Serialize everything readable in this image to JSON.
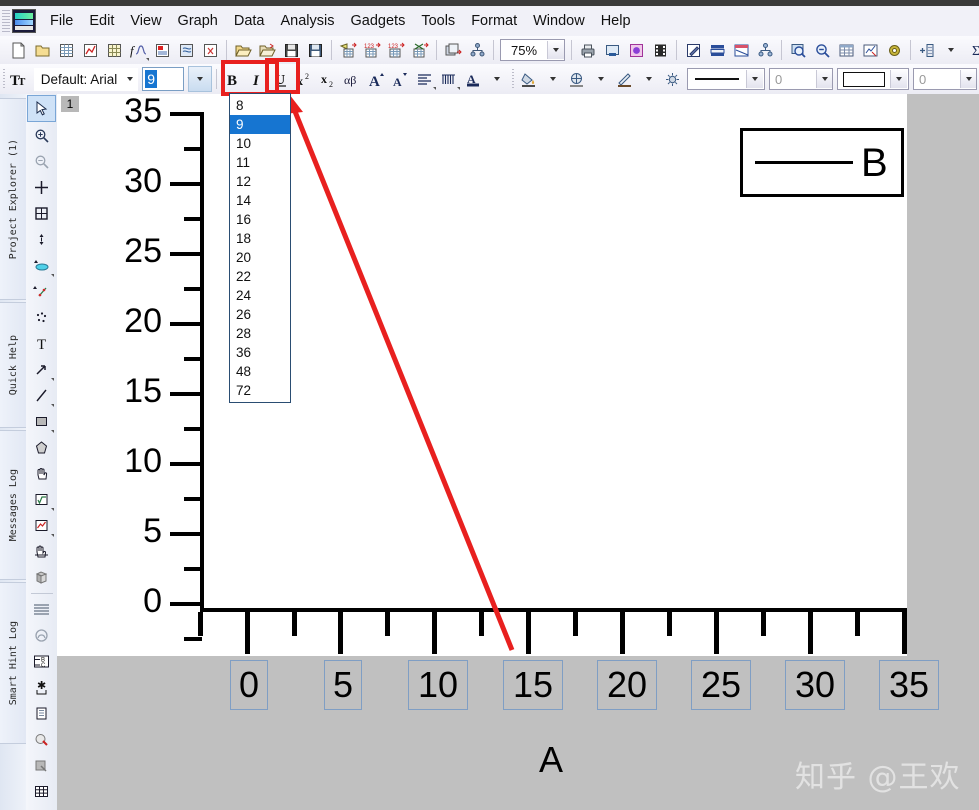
{
  "app": {
    "logo_icon": "origin-app-icon",
    "menu": [
      "File",
      "Edit",
      "View",
      "Graph",
      "Data",
      "Analysis",
      "Gadgets",
      "Tools",
      "Format",
      "Window",
      "Help"
    ]
  },
  "toolbar_standard": {
    "zoom_value": "75%",
    "buttons": [
      {
        "name": "new-project",
        "icon": "new-page-icon"
      },
      {
        "name": "new-folder",
        "icon": "new-folder-icon"
      },
      {
        "name": "new-workbook",
        "icon": "new-workbook-icon"
      },
      {
        "name": "new-graph",
        "icon": "new-graph-icon"
      },
      {
        "name": "new-matrix",
        "icon": "new-matrix-icon"
      },
      {
        "name": "new-function-plot",
        "icon": "function-plot-icon"
      },
      {
        "name": "new-layout",
        "icon": "new-layout-icon"
      },
      {
        "name": "new-notes",
        "icon": "new-notes-icon"
      },
      {
        "name": "new-excel",
        "icon": "new-excel-icon"
      },
      {
        "name": "open-project",
        "icon": "open-folder-icon"
      },
      {
        "name": "open-template",
        "icon": "open-template-icon"
      },
      {
        "name": "save-project",
        "icon": "save-icon"
      },
      {
        "name": "save-template",
        "icon": "save-template-icon"
      },
      {
        "name": "import-wizard",
        "icon": "import-wizard-icon"
      },
      {
        "name": "import-single-ascii",
        "icon": "import-ascii-icon"
      },
      {
        "name": "import-multiple-ascii",
        "icon": "import-multi-ascii-icon"
      },
      {
        "name": "export-data",
        "icon": "export-data-icon"
      },
      {
        "name": "duplicate",
        "icon": "duplicate-icon"
      },
      {
        "name": "project-tree",
        "icon": "project-tree-icon"
      }
    ],
    "buttons_right": [
      {
        "name": "print",
        "icon": "printer-icon"
      },
      {
        "name": "print-preview",
        "icon": "print-preview-icon"
      },
      {
        "name": "copy-page",
        "icon": "copy-page-icon"
      },
      {
        "name": "send-graph",
        "icon": "film-strip-icon"
      },
      {
        "name": "edit-mode",
        "icon": "edit-pencil-icon"
      },
      {
        "name": "layer-contents",
        "icon": "layers-icon"
      },
      {
        "name": "merge-graph",
        "icon": "merge-graph-icon"
      },
      {
        "name": "layer-management",
        "icon": "layer-mgmt-icon"
      },
      {
        "name": "zoom-in-tool",
        "icon": "magnifier-icon"
      },
      {
        "name": "zoom-out-tool",
        "icon": "magnifier-minus-icon"
      },
      {
        "name": "worksheet-view",
        "icon": "worksheet-icon"
      },
      {
        "name": "plot-setup",
        "icon": "plot-setup-icon"
      },
      {
        "name": "refresh",
        "icon": "refresh-gear-icon"
      },
      {
        "name": "add-layer",
        "icon": "add-layer-icon"
      },
      {
        "name": "statistics",
        "icon": "sigma-icon"
      },
      {
        "name": "stats-on-columns",
        "icon": "stats-columns-icon"
      },
      {
        "name": "sort",
        "icon": "sort-az-icon"
      }
    ]
  },
  "toolbar_format": {
    "font_label": "Default: Arial",
    "font_size_value": "9",
    "size_options": [
      "8",
      "9",
      "10",
      "11",
      "12",
      "14",
      "16",
      "18",
      "20",
      "22",
      "24",
      "26",
      "28",
      "36",
      "48",
      "72"
    ],
    "selected_size": "9",
    "bold_label": "B",
    "italic_label": "I",
    "underline_label": "U",
    "superscript_label": "x²",
    "subscript_label": "x₂",
    "greek_label": "αβ",
    "increase_font_label": "A",
    "decrease_font_label": "A",
    "line_width_value": "0",
    "fill_value": "0"
  },
  "dock_tabs": [
    {
      "label": "Project Explorer (1)",
      "name": "dock-tab-project-explorer"
    },
    {
      "label": "Quick Help",
      "name": "dock-tab-quick-help"
    },
    {
      "label": "Messages Log",
      "name": "dock-tab-messages-log"
    },
    {
      "label": "Smart Hint Log",
      "name": "dock-tab-smart-hint-log"
    }
  ],
  "tools": [
    {
      "name": "pointer-tool",
      "icon": "arrow-pointer-icon",
      "active": true
    },
    {
      "name": "zoom-in-tool",
      "icon": "magnifier-plus-icon"
    },
    {
      "name": "zoom-out-tool",
      "icon": "magnifier-minus-icon"
    },
    {
      "name": "screen-reader-tool",
      "icon": "crosshair-icon"
    },
    {
      "name": "region-select-tool",
      "icon": "region-select-icon"
    },
    {
      "name": "data-reader-tool",
      "icon": "data-reader-icon"
    },
    {
      "name": "data-selector-tool",
      "icon": "data-selector-icon"
    },
    {
      "name": "draw-data-tool",
      "icon": "draw-data-icon"
    },
    {
      "name": "regional-mask-tool",
      "icon": "mask-points-icon"
    },
    {
      "name": "text-tool",
      "icon": "text-t-icon"
    },
    {
      "name": "arrow-tool",
      "icon": "arrow-line-icon"
    },
    {
      "name": "line-tool",
      "icon": "straight-line-icon"
    },
    {
      "name": "rectangle-tool",
      "icon": "rectangle-icon"
    },
    {
      "name": "polygon-tool",
      "icon": "polygon-icon"
    },
    {
      "name": "hand-tool",
      "icon": "hand-icon"
    },
    {
      "name": "equation-tool",
      "icon": "sqrt-equation-icon"
    },
    {
      "name": "region-plot-tool",
      "icon": "region-plot-icon"
    },
    {
      "name": "scroll-graph-tool",
      "icon": "hand-scroll-icon"
    },
    {
      "name": "rotate-3d-tool",
      "icon": "rotate-cube-icon"
    },
    {
      "name": "style-bar-tool",
      "icon": "style-lines-icon"
    },
    {
      "name": "rescale-tool",
      "icon": "rescale-icon"
    },
    {
      "name": "swap-axes-tool",
      "icon": "swap-bc-icon"
    },
    {
      "name": "new-legend-tool",
      "icon": "asterisk-legend-icon"
    },
    {
      "name": "scale-in-tool",
      "icon": "scale-in-icon"
    },
    {
      "name": "speed-mode-tool",
      "icon": "speed-mode-icon"
    },
    {
      "name": "copy-format-tool",
      "icon": "copy-format-icon"
    },
    {
      "name": "grid-tool",
      "icon": "grid-table-icon"
    }
  ],
  "graph": {
    "layer_number": "1",
    "x_axis_title": "A",
    "legend": {
      "label": "B",
      "sample": "line"
    },
    "watermark": "知乎 @王欢"
  },
  "chart_data": {
    "type": "line",
    "title": "",
    "xlabel": "A",
    "ylabel": "",
    "xlim": [
      0,
      37
    ],
    "ylim": [
      0,
      36
    ],
    "x_ticks": [
      "0",
      "5",
      "10",
      "15",
      "20",
      "25",
      "30",
      "35"
    ],
    "y_ticks": [
      "0",
      "5",
      "10",
      "15",
      "20",
      "25",
      "30",
      "35"
    ],
    "x_tick_values": [
      0,
      5,
      10,
      15,
      20,
      25,
      30,
      35
    ],
    "y_tick_values": [
      0,
      5,
      10,
      15,
      20,
      25,
      30,
      35
    ],
    "minor_ticks_per_interval": 1,
    "grid": false,
    "legend_position": "top-right",
    "series": [
      {
        "name": "B",
        "values": [],
        "x": [],
        "color": "#000000"
      }
    ]
  },
  "annotation": {
    "highlight_color": "#e8201f",
    "arrow": {
      "from_x": 512,
      "from_y": 650,
      "to_x": 288,
      "to_y": 96
    }
  }
}
